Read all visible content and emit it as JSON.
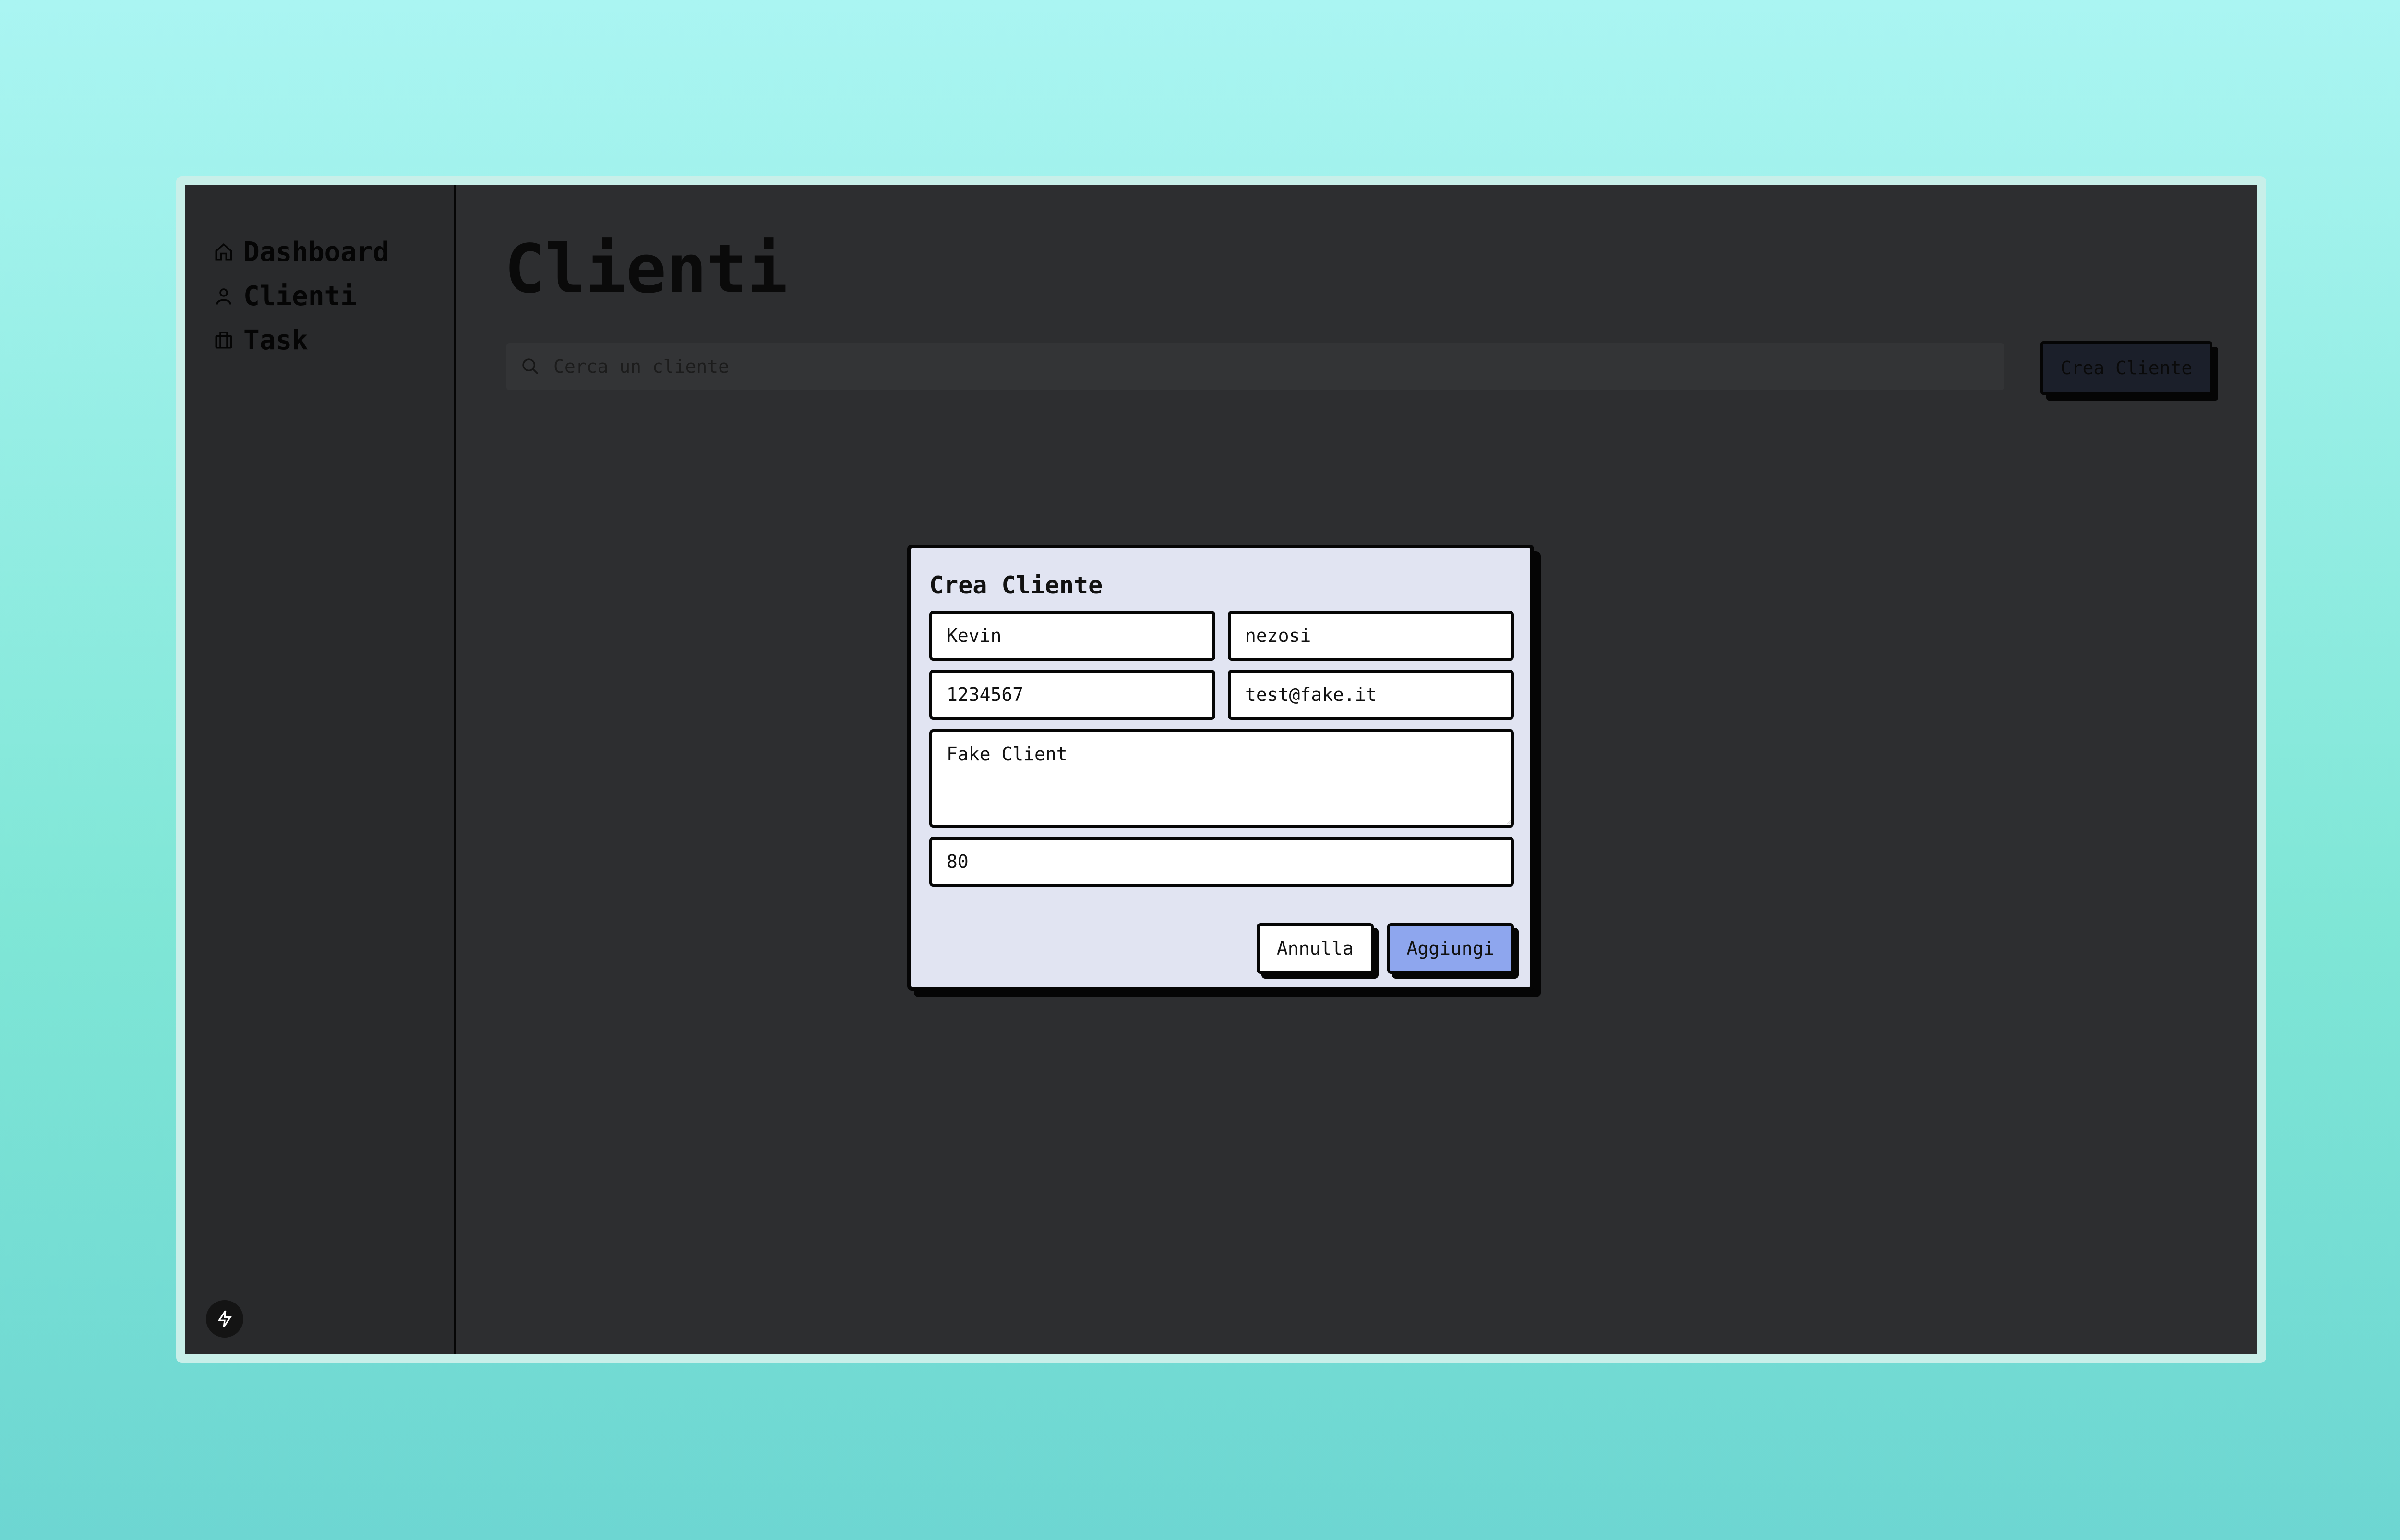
{
  "sidebar": {
    "items": [
      {
        "label": "Dashboard",
        "icon": "home-icon"
      },
      {
        "label": "Clienti",
        "icon": "user-icon"
      },
      {
        "label": "Task",
        "icon": "briefcase-icon"
      }
    ],
    "footer_icon": "bolt-icon"
  },
  "main": {
    "title": "Clienti",
    "search": {
      "placeholder": "Cerca un cliente",
      "value": ""
    },
    "create_button": "Crea Cliente"
  },
  "modal": {
    "title": "Crea Cliente",
    "fields": {
      "first_name": "Kevin",
      "last_name": "nezosi",
      "phone": "1234567",
      "email": "test@fake.it",
      "notes": "Fake Client",
      "number": "80"
    },
    "cancel_label": "Annulla",
    "submit_label": "Aggiungi"
  },
  "colors": {
    "background_gradient_top": "#aaf5f2",
    "background_gradient_bottom": "#6dd6d2",
    "window": "#2d2e30",
    "modal": "#e1e4f2",
    "primary_button": "#8ea6ee"
  }
}
